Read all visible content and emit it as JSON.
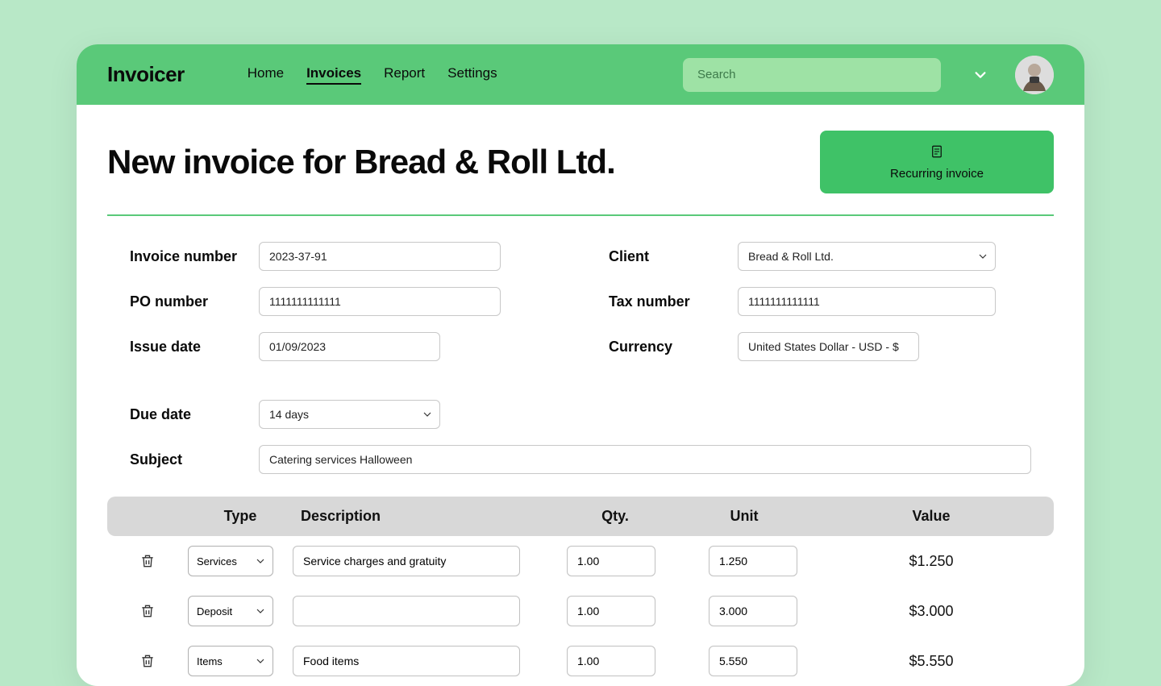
{
  "header": {
    "logo": "Invoicer",
    "nav": [
      "Home",
      "Invoices",
      "Report",
      "Settings"
    ],
    "activeNav": 1,
    "searchPlaceholder": "Search"
  },
  "page": {
    "title": "New invoice for Bread & Roll Ltd.",
    "recurringBtn": "Recurring invoice"
  },
  "form": {
    "left": {
      "invoiceNumber": {
        "label": "Invoice number",
        "value": "2023-37-91"
      },
      "poNumber": {
        "label": "PO number",
        "value": "1111111111111"
      },
      "issueDate": {
        "label": "Issue date",
        "value": "01/09/2023"
      },
      "dueDate": {
        "label": "Due date",
        "value": "14 days"
      },
      "subject": {
        "label": "Subject",
        "value": "Catering services Halloween"
      }
    },
    "right": {
      "client": {
        "label": "Client",
        "value": "Bread & Roll Ltd."
      },
      "taxNumber": {
        "label": "Tax number",
        "value": "1111111111111"
      },
      "currency": {
        "label": "Currency",
        "value": "United States Dollar - USD - $"
      }
    }
  },
  "lines": {
    "headers": [
      "Type",
      "Description",
      "Qty.",
      "Unit",
      "Value"
    ],
    "rows": [
      {
        "type": "Services",
        "description": "Service charges and gratuity",
        "qty": "1.00",
        "unit": "1.250",
        "value": "$1.250"
      },
      {
        "type": "Deposit",
        "description": "",
        "qty": "1.00",
        "unit": "3.000",
        "value": "$3.000"
      },
      {
        "type": "Items",
        "description": "Food items",
        "qty": "1.00",
        "unit": "5.550",
        "value": "$5.550"
      }
    ]
  }
}
